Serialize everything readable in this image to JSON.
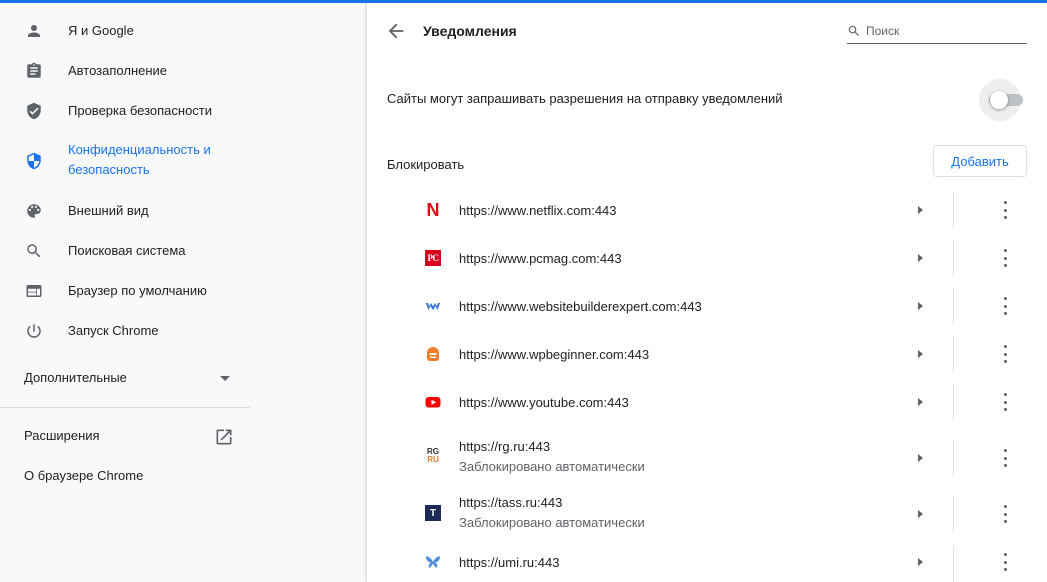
{
  "sidebar": {
    "items": [
      {
        "label": "Я и Google",
        "icon": "person-icon"
      },
      {
        "label": "Автозаполнение",
        "icon": "clipboard-icon"
      },
      {
        "label": "Проверка безопасности",
        "icon": "shield-check-icon"
      },
      {
        "label": "Конфиденциальность и безопасность",
        "icon": "shield-privacy-icon",
        "active": true
      },
      {
        "label": "Внешний вид",
        "icon": "palette-icon"
      },
      {
        "label": "Поисковая система",
        "icon": "search-icon"
      },
      {
        "label": "Браузер по умолчанию",
        "icon": "browser-icon"
      },
      {
        "label": "Запуск Chrome",
        "icon": "power-icon"
      }
    ],
    "advanced_label": "Дополнительные",
    "extensions_label": "Расширения",
    "about_label": "О браузере Chrome"
  },
  "header": {
    "title": "Уведомления",
    "search_placeholder": "Поиск"
  },
  "toggle": {
    "label": "Сайты могут запрашивать разрешения на отправку уведомлений",
    "enabled": false
  },
  "block": {
    "label": "Блокировать",
    "add_button": "Добавить"
  },
  "sites": [
    {
      "url": "https://www.netflix.com:443",
      "sub": "",
      "icon": "netflix-icon"
    },
    {
      "url": "https://www.pcmag.com:443",
      "sub": "",
      "icon": "pcmag-icon"
    },
    {
      "url": "https://www.websitebuilderexpert.com:443",
      "sub": "",
      "icon": "websitebuilderexpert-icon"
    },
    {
      "url": "https://www.wpbeginner.com:443",
      "sub": "",
      "icon": "wpbeginner-icon"
    },
    {
      "url": "https://www.youtube.com:443",
      "sub": "",
      "icon": "youtube-icon"
    },
    {
      "url": "https://rg.ru:443",
      "sub": "Заблокировано автоматически",
      "icon": "rg-icon"
    },
    {
      "url": "https://tass.ru:443",
      "sub": "Заблокировано автоматически",
      "icon": "tass-icon"
    },
    {
      "url": "https://umi.ru:443",
      "sub": "",
      "icon": "umi-icon"
    }
  ],
  "favicon_labels": {
    "netflix": "N",
    "pcmag": "PC",
    "rg_top": "RG",
    "rg_bottom": "RU",
    "tass": "T"
  },
  "colors": {
    "accent": "#1a73e8",
    "netflix": "#e50914",
    "pcmag": "#d6001c",
    "youtube": "#ff0000",
    "wpbeginner": "#f07d2a",
    "tass": "#1b2a56",
    "umi": "#4a90e2",
    "websitebuilderexpert": "#2f6fd6"
  }
}
